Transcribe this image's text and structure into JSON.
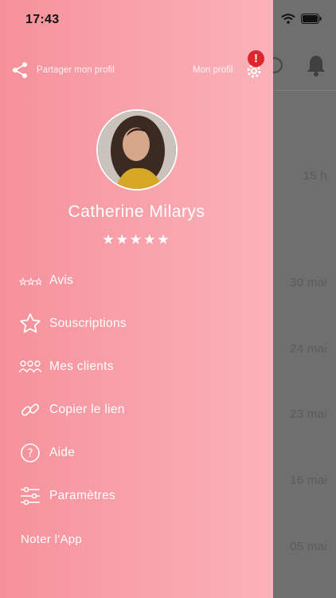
{
  "status_bar": {
    "time": "17:43"
  },
  "header": {
    "share_label": "Partager mon profil",
    "profile_label": "Mon profil",
    "alert_badge": "!"
  },
  "profile": {
    "name": "Catherine Milarys",
    "stars": "★★★★★"
  },
  "menu": [
    {
      "label": "Avis",
      "icon": "reviews-stars-icon"
    },
    {
      "label": "Souscriptions",
      "icon": "star-icon"
    },
    {
      "label": "Mes clients",
      "icon": "clients-icon"
    },
    {
      "label": "Copier le lien",
      "icon": "link-icon"
    },
    {
      "label": "Aide",
      "icon": "help-icon"
    },
    {
      "label": "Paramètres",
      "icon": "sliders-icon"
    }
  ],
  "footer": {
    "rate_app": "Noter l'App"
  },
  "background_list": {
    "times": [
      "15 h",
      "30 mai",
      "24 mai",
      "23 mai",
      "16 mai",
      "05 mai"
    ]
  },
  "colors": {
    "drawer_gradient_start": "#f6919b",
    "drawer_gradient_end": "#fbb2b8",
    "overlay": "#6f6f6f",
    "badge": "#e0262d"
  }
}
